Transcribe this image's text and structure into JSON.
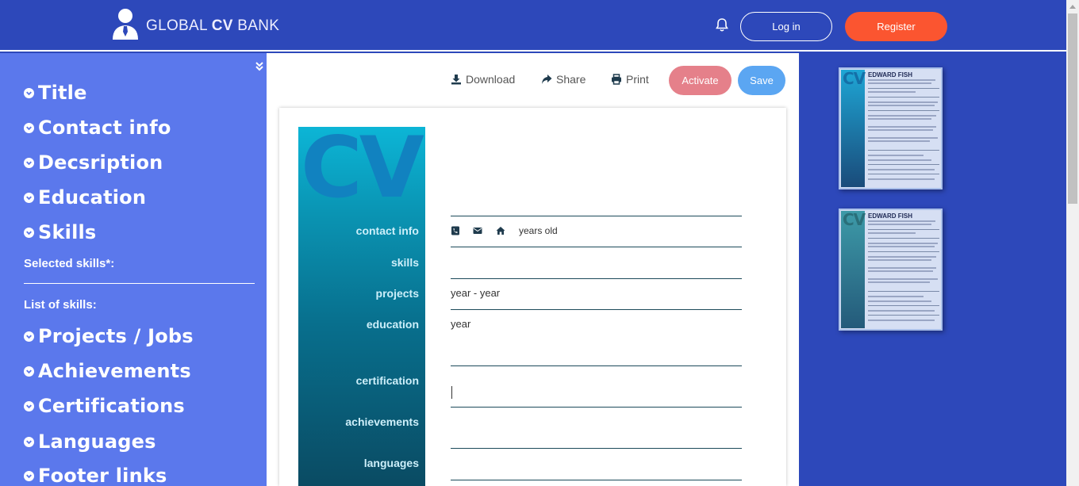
{
  "header": {
    "brand_prefix": "GLOBAL ",
    "brand_bold": "CV",
    "brand_suffix": " BANK",
    "login_label": "Log in",
    "register_label": "Register"
  },
  "sidebar": {
    "sections": [
      {
        "label": "Title"
      },
      {
        "label": "Contact info"
      },
      {
        "label": "Decsription"
      },
      {
        "label": "Education"
      },
      {
        "label": "Skills"
      },
      {
        "label": "Projects / Jobs"
      },
      {
        "label": "Achievements"
      },
      {
        "label": "Certifications"
      },
      {
        "label": "Languages"
      },
      {
        "label": "Footer links"
      }
    ],
    "selected_skills_label": "Selected skills*:",
    "list_of_skills_label": "List of skills:"
  },
  "toolbar": {
    "download_label": "Download",
    "share_label": "Share",
    "print_label": "Print",
    "activate_label": "Activate",
    "save_label": "Save"
  },
  "cv": {
    "logo": "CV",
    "labels": {
      "contact_info": "contact info",
      "skills": "skills",
      "projects": "projects",
      "education": "education",
      "certification": "certification",
      "achievements": "achievements",
      "languages": "languages"
    },
    "contact_text": "years old",
    "projects_text": "year - year",
    "education_text": "year"
  },
  "templates": [
    {
      "logo": "CV",
      "name": "EDWARD FISH"
    },
    {
      "logo": "CV",
      "name": "EDWARD FISH"
    }
  ],
  "colors": {
    "header_bg": "#2d48ba",
    "sidebar_bg": "#5b78ec",
    "register": "#fb5530",
    "activate": "#e5808a",
    "save": "#5ba6f2"
  }
}
